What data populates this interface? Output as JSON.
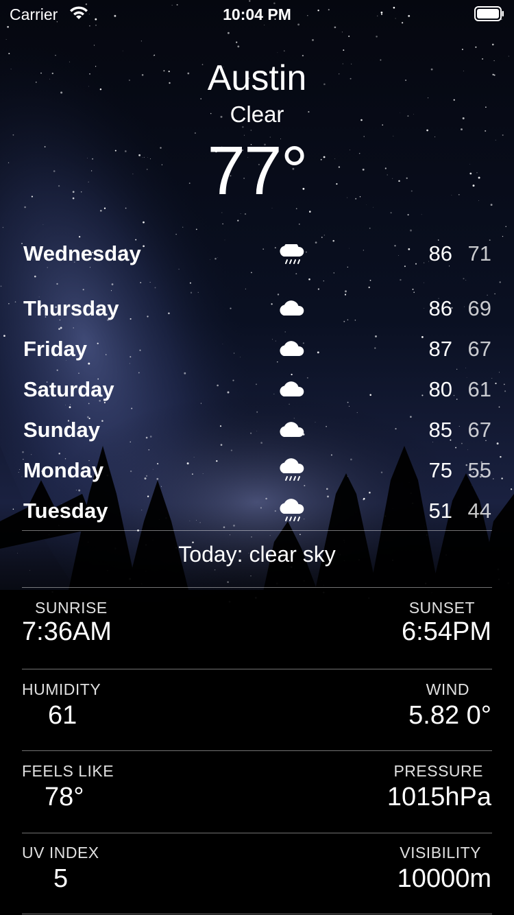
{
  "status_bar": {
    "carrier": "Carrier",
    "time": "10:04 PM"
  },
  "header": {
    "city": "Austin",
    "condition": "Clear",
    "temperature": "77°"
  },
  "forecast": [
    {
      "day": "Wednesday",
      "icon": "rain-cloud-icon",
      "high": "86",
      "low": "71"
    },
    {
      "day": "Thursday",
      "icon": "cloud-icon",
      "high": "86",
      "low": "69"
    },
    {
      "day": "Friday",
      "icon": "cloud-icon",
      "high": "87",
      "low": "67"
    },
    {
      "day": "Saturday",
      "icon": "cloud-icon",
      "high": "80",
      "low": "61"
    },
    {
      "day": "Sunday",
      "icon": "cloud-icon",
      "high": "85",
      "low": "67"
    },
    {
      "day": "Monday",
      "icon": "rain-cloud-icon",
      "high": "75",
      "low": "55"
    },
    {
      "day": "Tuesday",
      "icon": "rain-cloud-icon",
      "high": "51",
      "low": "44"
    }
  ],
  "summary": "Today: clear sky",
  "details": {
    "sunrise": {
      "label": "SUNRISE",
      "value": "7:36AM"
    },
    "sunset": {
      "label": "SUNSET",
      "value": "6:54PM"
    },
    "humidity": {
      "label": "HUMIDITY",
      "value": "61"
    },
    "wind": {
      "label": "WIND",
      "value": "5.82 0°"
    },
    "feels_like": {
      "label": "FEELS LIKE",
      "value": "78°"
    },
    "pressure": {
      "label": "PRESSURE",
      "value": "1015hPa"
    },
    "uv_index": {
      "label": "UV INDEX",
      "value": "5"
    },
    "visibility": {
      "label": "VISIBILITY",
      "value": "10000m"
    }
  },
  "colors": {
    "text": "#ffffff",
    "sky_top": "#05070f",
    "milky_way": "#4a5a8a",
    "background_bottom": "#000000"
  }
}
